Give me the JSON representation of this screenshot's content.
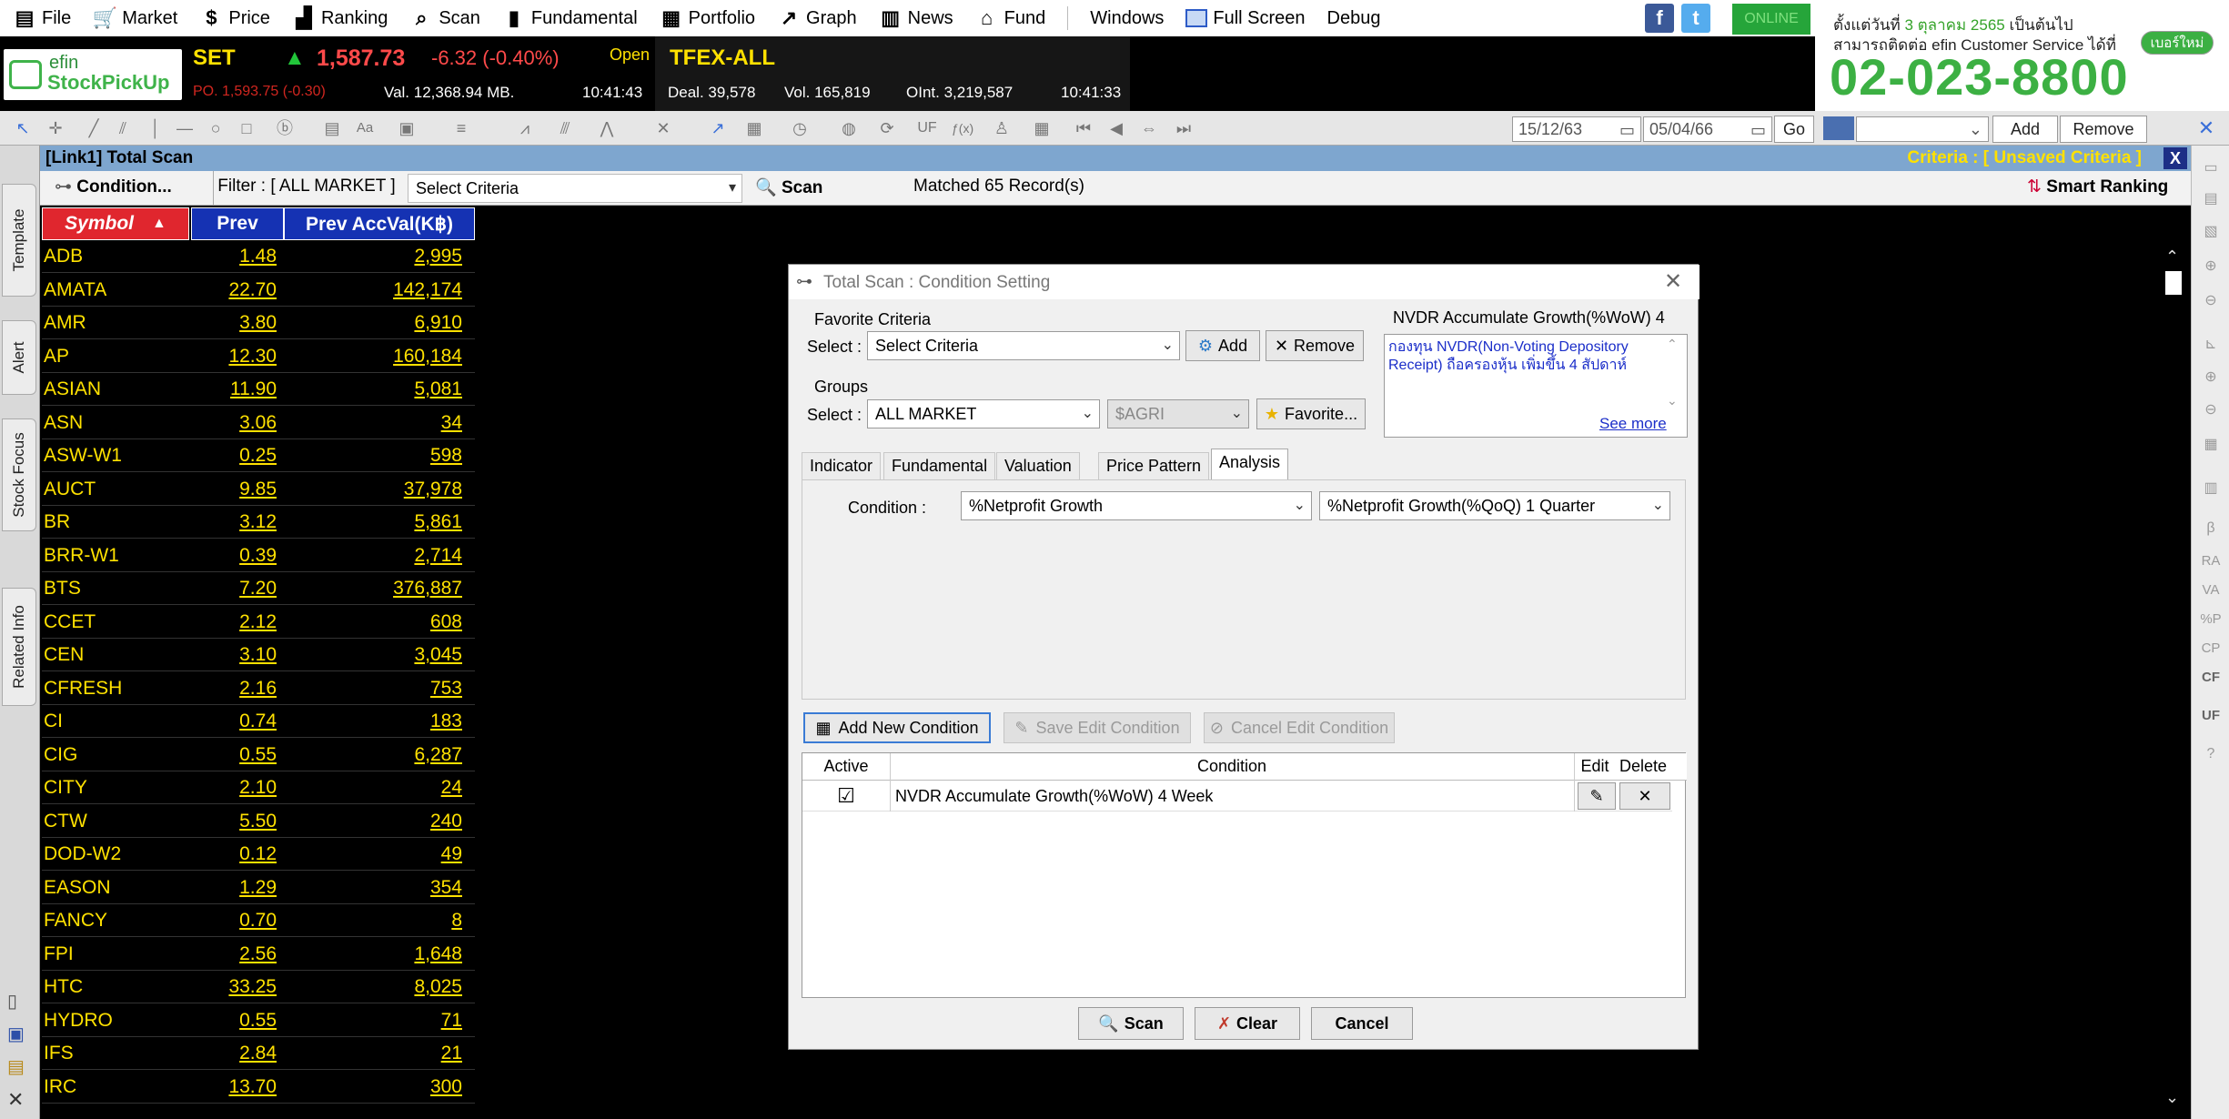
{
  "menu": [
    {
      "icon": "file-icon",
      "glyph": "▤",
      "label": "File"
    },
    {
      "icon": "cart-icon",
      "glyph": "🛒",
      "label": "Market"
    },
    {
      "icon": "dollar-icon",
      "glyph": "$",
      "label": "Price"
    },
    {
      "icon": "ranking-icon",
      "glyph": "▟",
      "label": "Ranking"
    },
    {
      "icon": "scan-icon",
      "glyph": "⌕",
      "label": "Scan"
    },
    {
      "icon": "fundamental-icon",
      "glyph": "▮",
      "label": "Fundamental"
    },
    {
      "icon": "portfolio-icon",
      "glyph": "▦",
      "label": "Portfolio"
    },
    {
      "icon": "graph-icon",
      "glyph": "↗",
      "label": "Graph"
    },
    {
      "icon": "news-icon",
      "glyph": "▥",
      "label": "News"
    },
    {
      "icon": "fund-icon",
      "glyph": "⌂",
      "label": "Fund"
    }
  ],
  "menu_plain": {
    "windows": "Windows",
    "fullscreen": "Full Screen",
    "debug": "Debug"
  },
  "status": {
    "online": "ONLINE"
  },
  "banner": {
    "line1_a": "ตั้งแต่วันที่ ",
    "line1_date": "3 ตุลาคม 2565",
    "line1_b": " เป็นต้นไป",
    "line2": "สามารถติดต่อ efin Customer Service ได้ที่",
    "button": "เบอร์ใหม่",
    "phone": "02-023-8800"
  },
  "logo": {
    "line1": "efin",
    "line2": "StockPickUp"
  },
  "ticker": {
    "set_label": "SET",
    "set_value": "1,587.73",
    "set_change": "-6.32 (-0.40%)",
    "market_state": "Open",
    "po": "PO. 1,593.75 (-0.30)",
    "val": "Val. 12,368.94 MB.",
    "time1": "10:41:43",
    "tfex_label": "TFEX-ALL",
    "deal": "Deal. 39,578",
    "vol": "Vol. 165,819",
    "oint": "OInt. 3,219,587",
    "time2": "10:41:33"
  },
  "toolbar": {
    "date_from": "15/12/63",
    "date_to": "05/04/66",
    "go": "Go",
    "add": "Add",
    "remove": "Remove"
  },
  "left_tabs": [
    "Template",
    "Alert",
    "Stock Focus",
    "Related Info"
  ],
  "scan": {
    "title": "[Link1] Total Scan",
    "criteria": "Criteria : [ Unsaved Criteria ]",
    "close": "X",
    "condition_btn": "Condition...",
    "filter": "Filter : [ ALL MARKET ]",
    "select_criteria": "Select Criteria",
    "scan_btn": "Scan",
    "matched": "Matched 65 Record(s)",
    "smart_ranking": "Smart Ranking"
  },
  "table": {
    "headers": [
      "Symbol",
      "Prev",
      "Prev AccVal(K฿)"
    ],
    "rows": [
      [
        "ADB",
        "1.48",
        "2,995"
      ],
      [
        "AMATA",
        "22.70",
        "142,174"
      ],
      [
        "AMR",
        "3.80",
        "6,910"
      ],
      [
        "AP",
        "12.30",
        "160,184"
      ],
      [
        "ASIAN",
        "11.90",
        "5,081"
      ],
      [
        "ASN",
        "3.06",
        "34"
      ],
      [
        "ASW-W1",
        "0.25",
        "598"
      ],
      [
        "AUCT",
        "9.85",
        "37,978"
      ],
      [
        "BR",
        "3.12",
        "5,861"
      ],
      [
        "BRR-W1",
        "0.39",
        "2,714"
      ],
      [
        "BTS",
        "7.20",
        "376,887"
      ],
      [
        "CCET",
        "2.12",
        "608"
      ],
      [
        "CEN",
        "3.10",
        "3,045"
      ],
      [
        "CFRESH",
        "2.16",
        "753"
      ],
      [
        "CI",
        "0.74",
        "183"
      ],
      [
        "CIG",
        "0.55",
        "6,287"
      ],
      [
        "CITY",
        "2.10",
        "24"
      ],
      [
        "CTW",
        "5.50",
        "240"
      ],
      [
        "DOD-W2",
        "0.12",
        "49"
      ],
      [
        "EASON",
        "1.29",
        "354"
      ],
      [
        "FANCY",
        "0.70",
        "8"
      ],
      [
        "FPI",
        "2.56",
        "1,648"
      ],
      [
        "HTC",
        "33.25",
        "8,025"
      ],
      [
        "HYDRO",
        "0.55",
        "71"
      ],
      [
        "IFS",
        "2.84",
        "21"
      ],
      [
        "IRC",
        "13.70",
        "300"
      ]
    ]
  },
  "dialog": {
    "title": "Total Scan : Condition Setting",
    "favorite_criteria": "Favorite Criteria",
    "select_label": "Select :",
    "fav_select": "Select Criteria",
    "add": "Add",
    "remove": "Remove",
    "groups": "Groups",
    "group_select": "ALL MARKET",
    "group_sub": "$AGRI",
    "favorite_btn": "Favorite...",
    "info_title": "NVDR Accumulate Growth(%WoW) 4",
    "info_text": "กองทุน NVDR(Non-Voting Depository Receipt) ถือครองหุ้น เพิ่มขึ้น 4 สัปดาห์",
    "see_more": "See more",
    "tabs": [
      "Indicator",
      "Fundamental",
      "Valuation",
      "Price Pattern",
      "Analysis"
    ],
    "condition_label": "Condition :",
    "condition_1": "%Netprofit Growth",
    "condition_2": "%Netprofit Growth(%QoQ) 1 Quarter",
    "add_new": "Add New Condition",
    "save_edit": "Save Edit Condition",
    "cancel_edit": "Cancel Edit Condition",
    "grid_headers": [
      "Active",
      "Condition",
      "Edit",
      "Delete"
    ],
    "grid_rows": [
      {
        "active": "☑",
        "condition": "NVDR Accumulate Growth(%WoW) 4 Week"
      }
    ],
    "scan_btn": "Scan",
    "clear_btn": "Clear",
    "cancel_btn": "Cancel"
  },
  "colors": {
    "accent_green": "#3cb043",
    "ticker_up": "#22c63a",
    "ticker_down": "#ff4a4a",
    "table_text": "#ffe100",
    "symbol_header": "#e0262e",
    "prev_header": "#1532b3",
    "title_bar": "#7ea6cf"
  }
}
